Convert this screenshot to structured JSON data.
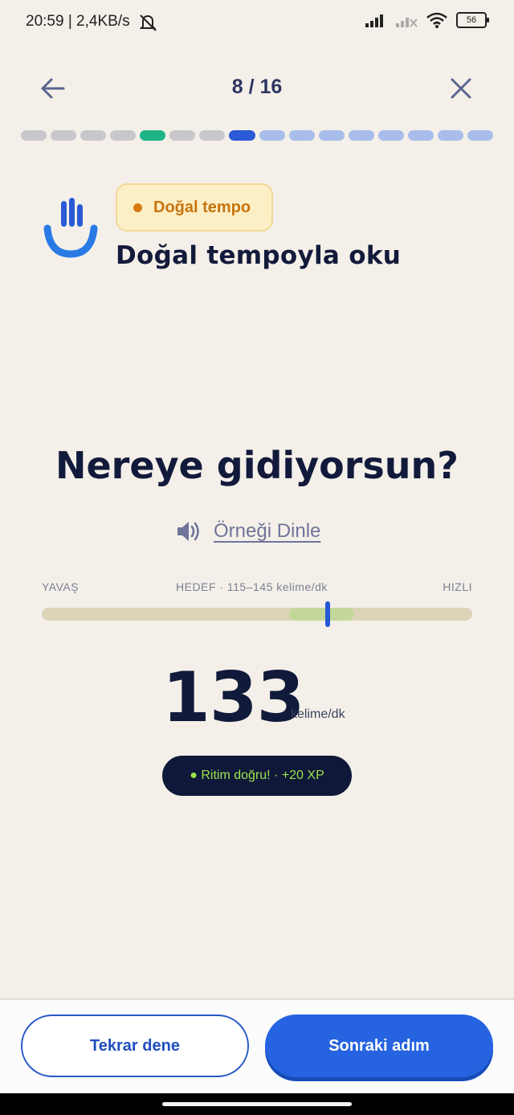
{
  "status_bar": {
    "time": "20:59 | 2,4KB/s",
    "battery": "56",
    "icons": [
      "mute-bell-icon",
      "signal-icon",
      "signal-off-icon",
      "wifi-icon",
      "battery-icon"
    ]
  },
  "header": {
    "counter": "8 / 16",
    "back_icon": "arrow-left-icon",
    "close_icon": "close-icon"
  },
  "progress": {
    "total": 16,
    "current": 8,
    "segments": [
      "done",
      "done",
      "done",
      "done",
      "success",
      "done",
      "done",
      "current",
      "todo",
      "todo",
      "todo",
      "todo",
      "todo",
      "todo",
      "todo",
      "todo"
    ],
    "colors": {
      "done": "#c8c8cc",
      "success": "#1fb487",
      "current": "#2a5ad6",
      "todo": "#a8bdea"
    }
  },
  "exercise": {
    "badge": "Doğal tempo",
    "title": "Doğal tempoyla oku",
    "sentence": "Nereye gidiyorsun?",
    "listen_label": "Örneği Dinle"
  },
  "tempo": {
    "slow_label": "YAVAŞ",
    "target_label": "HEDEF · 115–145 kelime/dk",
    "fast_label": "HIZLI",
    "target_zone_fraction": [
      0.575,
      0.725
    ],
    "marker_fraction": 0.665,
    "value": "133",
    "unit": "kelime/dk",
    "feedback": "● Ritim doğru! · +20 XP"
  },
  "footer": {
    "retry_label": "Tekrar dene",
    "next_label": "Sonraki adım"
  },
  "colors": {
    "background": "#f4f0e9",
    "primary": "#2563e0",
    "navy": "#0f1838",
    "accent_green": "#9be44d",
    "badge_orange": "#c6740f"
  }
}
